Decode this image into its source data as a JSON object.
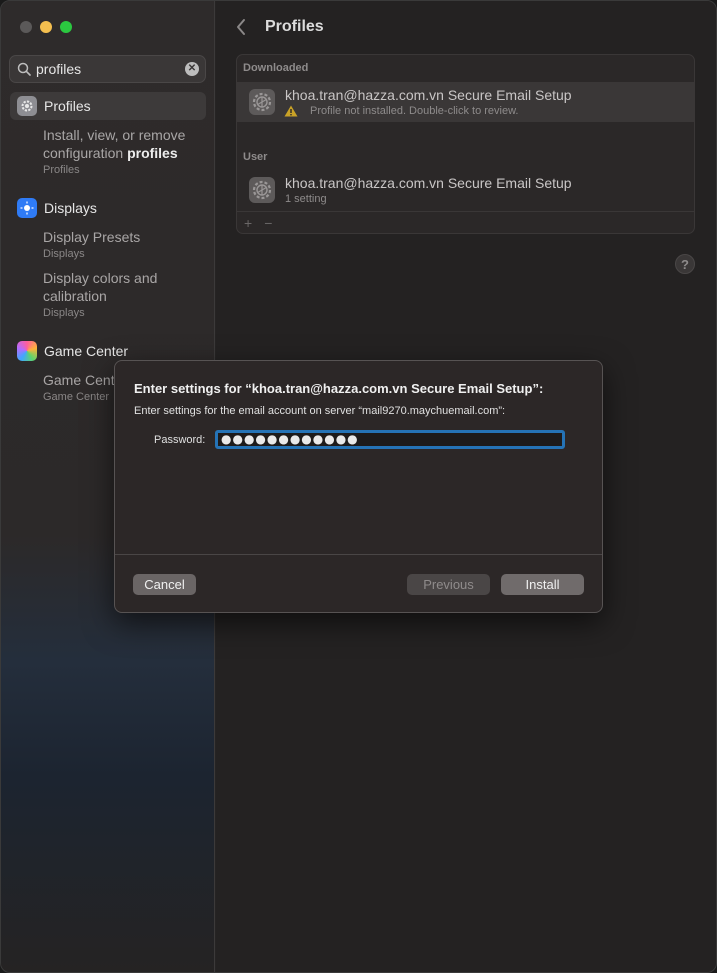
{
  "window": {
    "traffic_lights": {
      "close": "#5b5959",
      "minimize": "#f4bf4f",
      "maximize": "#2bc840"
    }
  },
  "sidebar": {
    "search": {
      "value": "profiles",
      "icon": "magnifier-icon",
      "clear_icon": "clear-icon"
    },
    "results": [
      {
        "label": "Profiles",
        "icon": "profiles-gear-icon",
        "selected": true,
        "subs": [
          {
            "text_pre": "Install, view, or remove configuration ",
            "text_bold": "profiles",
            "category": "Profiles"
          }
        ]
      },
      {
        "label": "Displays",
        "icon": "displays-sun-icon",
        "subs": [
          {
            "text": "Display Presets",
            "category": "Displays"
          },
          {
            "text": "Display colors and calibration",
            "category": "Displays"
          }
        ]
      },
      {
        "label": "Game Center",
        "icon": "game-center-icon",
        "subs": [
          {
            "text": "Game Center",
            "category": "Game Center"
          }
        ]
      }
    ]
  },
  "main": {
    "title": "Profiles",
    "sections": {
      "downloaded": {
        "label": "Downloaded",
        "items": [
          {
            "name": "khoa.tran@hazza.com.vn Secure Email Setup",
            "detail": "Profile not installed. Double-click to review."
          }
        ]
      },
      "user": {
        "label": "User",
        "items": [
          {
            "name": "khoa.tran@hazza.com.vn Secure Email Setup",
            "detail": "1 setting"
          }
        ]
      }
    },
    "add_label": "+",
    "remove_label": "−",
    "help_label": "?"
  },
  "dialog": {
    "title": "Enter settings for “khoa.tran@hazza.com.vn Secure Email Setup”:",
    "subtitle": "Enter settings for the email account on server “mail9270.maychuemail.com”:",
    "password_label": "Password:",
    "password_value": "●●●●●●●●●●●●",
    "buttons": {
      "cancel": "Cancel",
      "previous": "Previous",
      "install": "Install"
    },
    "accent": "#2573b6"
  }
}
